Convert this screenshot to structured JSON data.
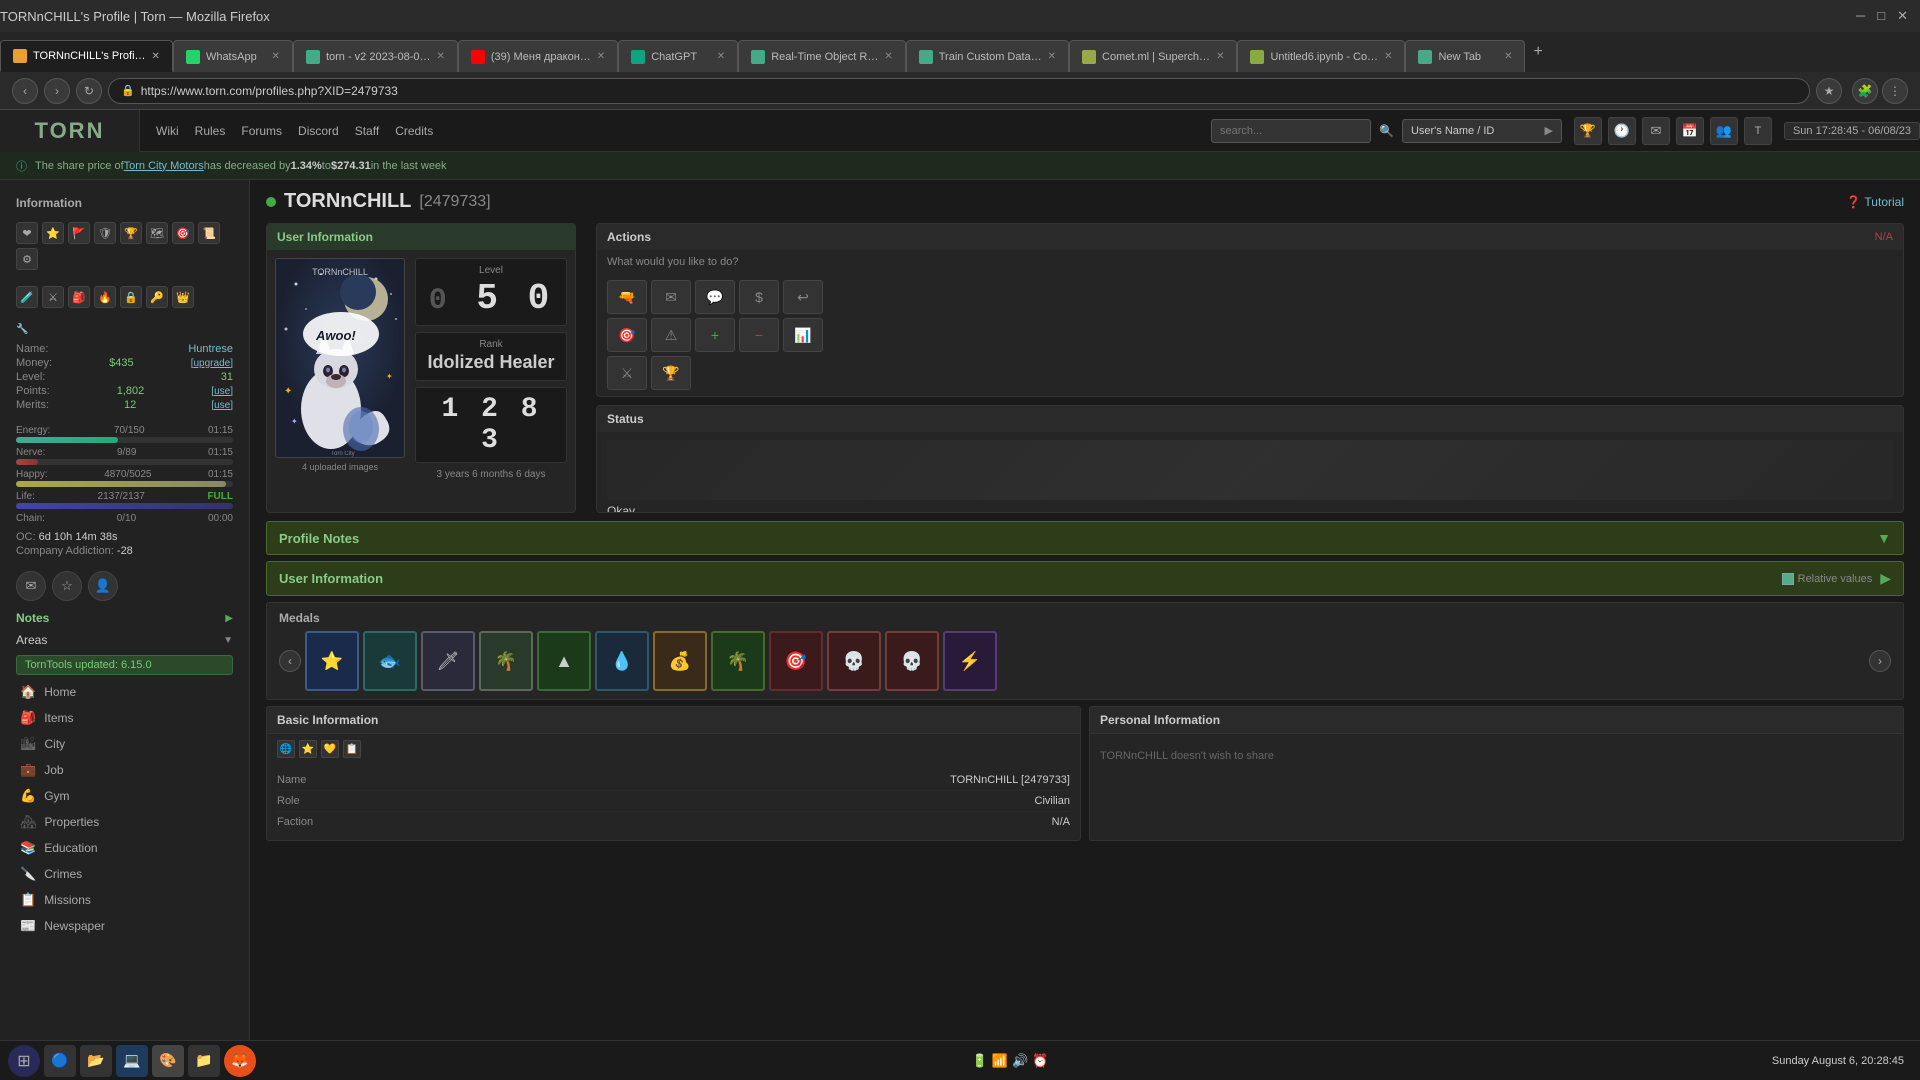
{
  "browser": {
    "title": "TORNnCHILL's Profile | Torn — Mozilla Firefox",
    "url": "https://www.torn.com/profiles.php?XID=2479733",
    "tabs": [
      {
        "id": "torn-profile",
        "label": "TORNnCHILL's Profi…",
        "active": true,
        "icon_color": "#e8a030"
      },
      {
        "id": "whatsapp",
        "label": "WhatsApp",
        "active": false,
        "icon_color": "#25d366"
      },
      {
        "id": "torn-v2",
        "label": "torn - v2 2023-08-0…",
        "active": false,
        "icon_color": "#4a8"
      },
      {
        "id": "youtube",
        "label": "(39) Меня дракон…",
        "active": false,
        "icon_color": "#f00"
      },
      {
        "id": "chatgpt",
        "label": "ChatGPT",
        "active": false,
        "icon_color": "#10a37f"
      },
      {
        "id": "realtimeobj",
        "label": "Real-Time Object R…",
        "active": false,
        "icon_color": "#4a8"
      },
      {
        "id": "train",
        "label": "Train Custom Data…",
        "active": false,
        "icon_color": "#4a8"
      },
      {
        "id": "comet",
        "label": "Comet.ml | Superch…",
        "active": false,
        "icon_color": "#9a4"
      },
      {
        "id": "untitled6",
        "label": "Untitled6.ipynb - Co…",
        "active": false,
        "icon_color": "#8a4"
      },
      {
        "id": "newtab",
        "label": "New Tab",
        "active": false,
        "icon_color": "#4a8"
      }
    ]
  },
  "torn": {
    "logo": "TORN",
    "nav_links": [
      "Wiki",
      "Rules",
      "Forums",
      "Discord",
      "Staff",
      "Credits"
    ],
    "search_placeholder": "search...",
    "user_id_placeholder": "User's Name / ID",
    "datetime": "Sun 17:28:45 - 06/08/23",
    "notification": "The share price of Torn City Motors has decreased by 1.34% to $274.31 in the last week",
    "notification_company": "Torn City Motors"
  },
  "sidebar": {
    "section_title": "Information",
    "user": {
      "name_label": "Name:",
      "name_value": "Huntrese",
      "money_label": "Money:",
      "money_value": "$435",
      "upgrade_label": "[upgrade]",
      "level_label": "Level:",
      "level_value": "31",
      "points_label": "Points:",
      "points_value": "1,802",
      "use_label": "[use]",
      "merits_label": "Merits:",
      "merits_value": "12"
    },
    "stats": {
      "energy_label": "Energy:",
      "energy_current": "70",
      "energy_max": "150",
      "energy_time": "01:15",
      "energy_pct": 47,
      "nerve_label": "Nerve:",
      "nerve_current": "9",
      "nerve_max": "89",
      "nerve_time": "01:15",
      "nerve_pct": 10,
      "happy_label": "Happy:",
      "happy_current": "4870",
      "happy_max": "5025",
      "happy_time": "01:15",
      "happy_pct": 97,
      "life_label": "Life:",
      "life_current": "2137",
      "life_max": "2137",
      "life_status": "FULL",
      "life_pct": 100
    },
    "chain_label": "Chain:",
    "chain_value": "0/10",
    "chain_time": "00:00",
    "oc_label": "OC:",
    "oc_value": "6d 10h 14m 38s",
    "company_addiction_label": "Company Addiction:",
    "company_addiction_value": "-28",
    "notes_label": "Notes",
    "areas_label": "Areas",
    "tools_badge": "TornTools updated: 6.15.0",
    "menu_items": [
      {
        "id": "home",
        "label": "Home",
        "icon": "🏠"
      },
      {
        "id": "items",
        "label": "Items",
        "icon": "🎒"
      },
      {
        "id": "city",
        "label": "City",
        "icon": "🏙"
      },
      {
        "id": "job",
        "label": "Job",
        "icon": "💼"
      },
      {
        "id": "gym",
        "label": "Gym",
        "icon": "💪"
      },
      {
        "id": "properties",
        "label": "Properties",
        "icon": "🏘"
      },
      {
        "id": "education",
        "label": "Education",
        "icon": "📚"
      },
      {
        "id": "crimes",
        "label": "Crimes",
        "icon": "🔪"
      },
      {
        "id": "missions",
        "label": "Missions",
        "icon": "📋"
      },
      {
        "id": "newspaper",
        "label": "Newspaper",
        "icon": "📰"
      }
    ]
  },
  "profile": {
    "online_status": "online",
    "name": "TORNnCHILL",
    "id": "[2479733]",
    "tutorial_label": "Tutorial",
    "user_info_title": "User Information",
    "avatar_caption": "4 uploaded images",
    "level": {
      "label": "Level",
      "value": "50",
      "display": "0 5 0"
    },
    "rank": {
      "label": "Rank",
      "value": "Idolized Healer"
    },
    "score": {
      "value": "1 2 8 3"
    },
    "time_played": "3 years 6 months 6 days",
    "actions": {
      "title": "Actions",
      "subtitle": "What would you like to do?",
      "na_label": "N/A",
      "buttons": [
        {
          "icon": "🔫",
          "name": "attack-btn"
        },
        {
          "icon": "✉",
          "name": "message-btn"
        },
        {
          "icon": "💬",
          "name": "trade-btn"
        },
        {
          "icon": "$",
          "name": "bounty-btn"
        },
        {
          "icon": "↩",
          "name": "friend-btn"
        },
        {
          "icon": "🎯",
          "name": "stalk-btn"
        },
        {
          "icon": "⚠",
          "name": "report-btn"
        },
        {
          "icon": "+",
          "name": "add-btn",
          "green": true
        },
        {
          "icon": "-",
          "name": "remove-btn",
          "red": true
        },
        {
          "icon": "📊",
          "name": "stats-btn"
        },
        {
          "icon": "⚔",
          "name": "compare-btn"
        },
        {
          "icon": "🏆",
          "name": "awards-btn"
        }
      ]
    },
    "status": {
      "title": "Status",
      "value": "Okay"
    },
    "profile_notes_label": "Profile Notes",
    "user_info_bar_label": "User Information",
    "relative_values_label": "Relative values",
    "medals_title": "Medals",
    "medals": [
      {
        "color": "blue",
        "icon": "⭐"
      },
      {
        "color": "teal",
        "icon": "🐟"
      },
      {
        "color": "gray",
        "icon": "🗡"
      },
      {
        "color": "light",
        "icon": "🌴"
      },
      {
        "color": "green",
        "icon": "▲"
      },
      {
        "color": "cyan",
        "icon": "💧"
      },
      {
        "color": "yellow",
        "icon": "💰"
      },
      {
        "color": "palm",
        "icon": "🌴"
      },
      {
        "color": "red-dark",
        "icon": "🎯"
      },
      {
        "color": "skull",
        "icon": "💀"
      },
      {
        "color": "skull2",
        "icon": "💀"
      },
      {
        "color": "lightning",
        "icon": "⚡"
      }
    ],
    "basic_info": {
      "title": "Basic Information",
      "icons": [
        "🌐",
        "⭐",
        "💛",
        "📋"
      ],
      "rows": [
        {
          "key": "Name",
          "value": "TORNnCHILL [2479733]"
        },
        {
          "key": "Role",
          "value": "Civilian"
        },
        {
          "key": "Faction",
          "value": "N/A"
        }
      ]
    },
    "personal_info": {
      "title": "Personal Information",
      "content": "TORNnCHILL doesn't wish to share"
    }
  },
  "taskbar": {
    "time": "Sunday August 6, 20:28:45",
    "icons": [
      "⊞",
      "🔵",
      "📂",
      "💻",
      "🎨",
      "📁"
    ]
  }
}
